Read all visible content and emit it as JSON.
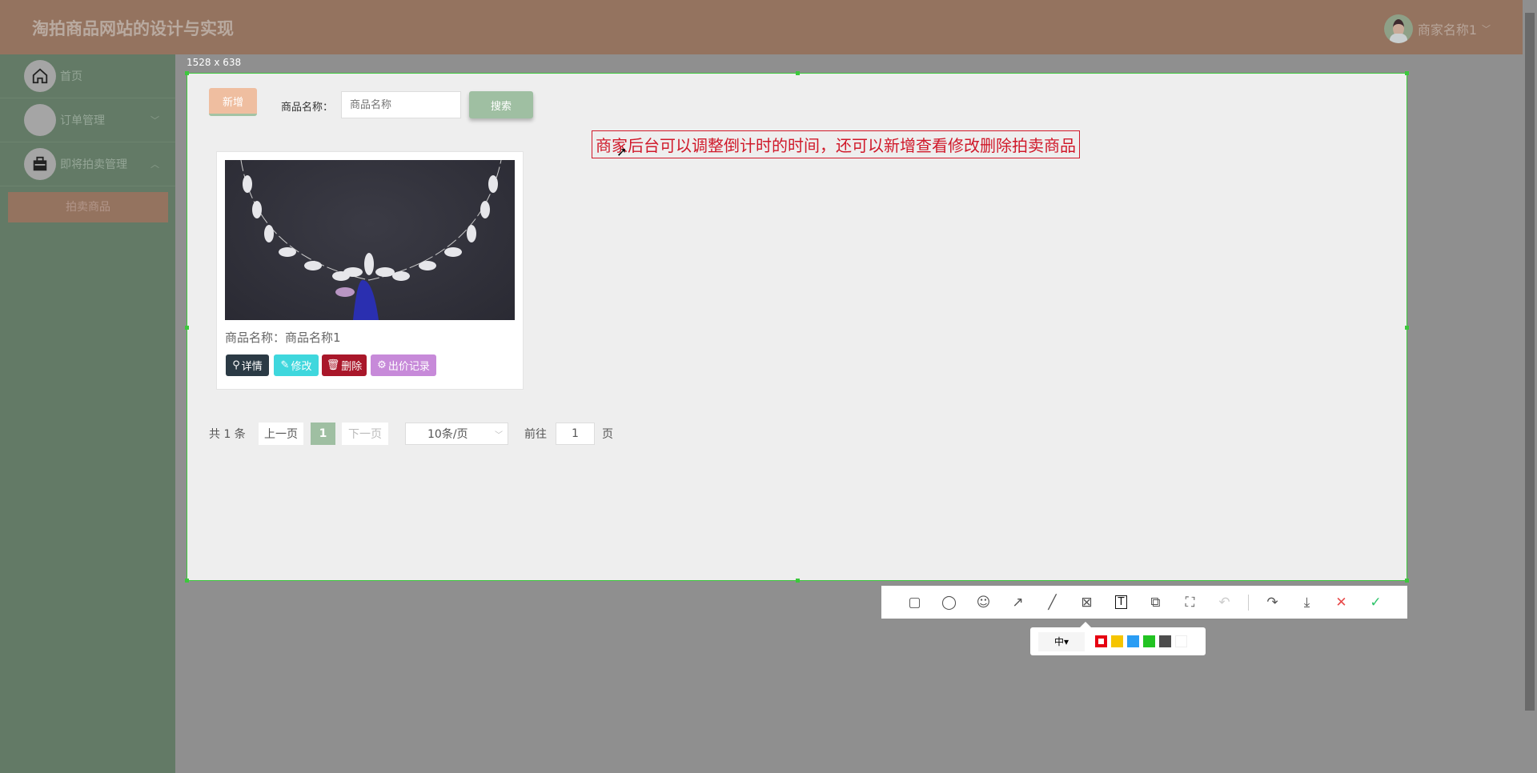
{
  "header": {
    "title": "淘拍商品网站的设计与实现",
    "user_name": "商家名称1"
  },
  "sidebar": {
    "items": [
      {
        "label": "首页",
        "icon": "home-icon"
      },
      {
        "label": "订单管理",
        "icon": "blank-icon"
      },
      {
        "label": "即将拍卖管理",
        "icon": "briefcase-icon"
      }
    ],
    "subitems": [
      {
        "label": "拍卖商品"
      }
    ]
  },
  "capture": {
    "size_label": "1528 x 638"
  },
  "toolbar": {
    "add_label": "新增",
    "search_label": "商品名称：",
    "search_placeholder": "商品名称",
    "search_button": "搜索"
  },
  "annotation": {
    "text": "商家后台可以调整倒计时的时间，还可以新增查看修改删除拍卖商品",
    "color": "#d0192a"
  },
  "card": {
    "name_label": "商品名称：",
    "name_value": "商品名称1",
    "buttons": {
      "detail": "详情",
      "edit": "修改",
      "delete": "删除",
      "bids": "出价记录"
    }
  },
  "pagination": {
    "total": "共 1 条",
    "prev": "上一页",
    "current": "1",
    "next": "下一页",
    "page_size": "10条/页",
    "goto": "前往",
    "goto_value": "1",
    "page_suffix": "页"
  },
  "screenshot_tool": {
    "tools": [
      "rectangle-icon",
      "ellipse-icon",
      "emoji-icon",
      "arrow-icon",
      "pen-icon",
      "mosaic-icon",
      "text-icon",
      "pin-icon",
      "ocr-icon",
      "undo-icon",
      "share-icon",
      "download-icon",
      "close-icon",
      "confirm-icon"
    ],
    "size_option": "中",
    "colors": [
      "#e60012",
      "#f5c400",
      "#2a9df4",
      "#22c322",
      "#4d4d4d",
      "#ffffff"
    ]
  }
}
